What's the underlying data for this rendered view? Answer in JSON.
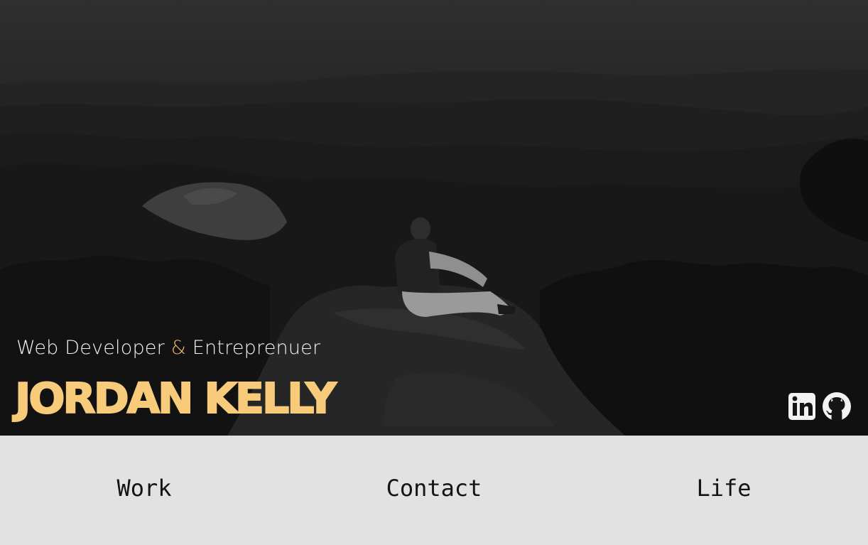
{
  "hero": {
    "tagline_part1": "Web Developer",
    "tagline_amp": "&",
    "tagline_part2": "Entreprenuer",
    "name": "JORDAN KELLY",
    "background_image": "man-sitting-on-mountain-overlook-photo"
  },
  "social": [
    {
      "name": "LinkedIn",
      "icon": "linkedin-icon"
    },
    {
      "name": "GitHub",
      "icon": "github-icon"
    }
  ],
  "nav": {
    "items": [
      "Work",
      "Contact",
      "Life"
    ]
  },
  "colors": {
    "accent": "#f7cb7a",
    "amp": "#e6b668",
    "nav_background": "#e2e2e2",
    "hero_overlay": "#1a1a1a"
  }
}
